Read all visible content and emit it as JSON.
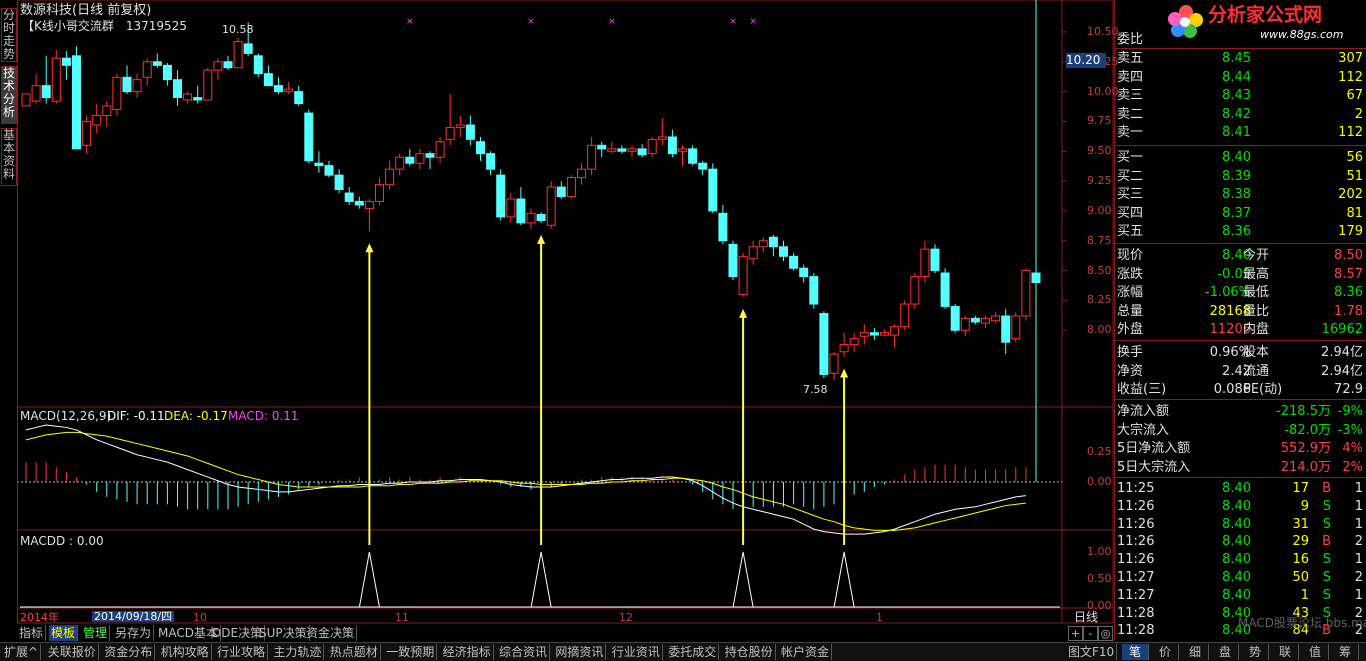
{
  "header": {
    "title": "数源科技(日线 前复权)",
    "group_note": "【K线小哥交流群　13719525",
    "label_high": "10.58",
    "label_low": "7.58"
  },
  "side_tabs": [
    "分时走势",
    "技术分析",
    "基本资料"
  ],
  "price_axis": [
    "10.50",
    "10.25",
    "10.00",
    "9.75",
    "9.50",
    "9.25",
    "9.00",
    "8.75",
    "8.50",
    "8.25",
    "8.00"
  ],
  "current_price_box": "10.20",
  "macd": {
    "title": "MACD(12,26,9)",
    "dif": "DIF: -0.11",
    "dea": "DEA: -0.17",
    "macd": "MACD: 0.11",
    "axis": [
      "0.25",
      "0.00"
    ]
  },
  "macdd": {
    "title": "MACDD : 0.00",
    "axis": [
      "1.00",
      "0.50",
      "0.00"
    ]
  },
  "date_axis": {
    "year": "2014年",
    "cursor_date": "2014/09/18/四",
    "months": [
      "10",
      "11",
      "12",
      "1"
    ],
    "period": "日线"
  },
  "chart_data": {
    "type": "candlestick",
    "title": "数源科技(日线 前复权)",
    "ylim": [
      7.55,
      10.6
    ],
    "candles": [
      [
        9.88,
        9.98,
        9.92,
        9.98
      ],
      [
        9.92,
        10.15,
        9.9,
        10.05
      ],
      [
        10.05,
        10.3,
        9.9,
        9.95
      ],
      [
        9.92,
        10.35,
        9.9,
        10.28
      ],
      [
        10.28,
        10.34,
        10.1,
        10.22
      ],
      [
        10.3,
        10.38,
        9.55,
        9.52
      ],
      [
        9.55,
        9.8,
        9.48,
        9.75
      ],
      [
        9.72,
        9.9,
        9.65,
        9.8
      ],
      [
        9.8,
        9.92,
        9.7,
        9.88
      ],
      [
        9.85,
        10.15,
        9.8,
        10.12
      ],
      [
        10.12,
        10.22,
        9.98,
        10.0
      ],
      [
        10.0,
        10.15,
        9.95,
        10.1
      ],
      [
        10.12,
        10.28,
        10.05,
        10.25
      ],
      [
        10.25,
        10.32,
        10.2,
        10.22
      ],
      [
        10.22,
        10.24,
        10.05,
        10.1
      ],
      [
        10.1,
        10.18,
        9.88,
        9.95
      ],
      [
        9.93,
        10.0,
        9.9,
        9.98
      ],
      [
        9.95,
        10.05,
        9.9,
        9.93
      ],
      [
        9.93,
        10.2,
        9.95,
        10.18
      ],
      [
        10.18,
        10.28,
        10.1,
        10.25
      ],
      [
        10.25,
        10.3,
        10.18,
        10.2
      ],
      [
        10.2,
        10.45,
        10.22,
        10.42
      ],
      [
        10.4,
        10.58,
        10.3,
        10.32
      ],
      [
        10.3,
        10.32,
        10.12,
        10.15
      ],
      [
        10.15,
        10.22,
        10.05,
        10.05
      ],
      [
        10.05,
        10.12,
        9.98,
        10.0
      ],
      [
        10.0,
        10.08,
        9.98,
        10.02
      ],
      [
        10.0,
        10.05,
        9.88,
        9.9
      ],
      [
        9.82,
        9.85,
        9.4,
        9.42
      ],
      [
        9.4,
        9.5,
        9.32,
        9.38
      ],
      [
        9.38,
        9.42,
        9.28,
        9.3
      ],
      [
        9.3,
        9.35,
        9.15,
        9.18
      ],
      [
        9.15,
        9.2,
        9.05,
        9.08
      ],
      [
        9.08,
        9.12,
        9.02,
        9.05
      ],
      [
        9.02,
        9.1,
        8.83,
        9.08
      ],
      [
        9.08,
        9.28,
        9.05,
        9.22
      ],
      [
        9.22,
        9.42,
        9.18,
        9.35
      ],
      [
        9.35,
        9.48,
        9.3,
        9.45
      ],
      [
        9.45,
        9.52,
        9.38,
        9.4
      ],
      [
        9.4,
        9.52,
        9.35,
        9.48
      ],
      [
        9.48,
        9.5,
        9.35,
        9.45
      ],
      [
        9.45,
        9.62,
        9.4,
        9.58
      ],
      [
        9.6,
        9.98,
        9.55,
        9.7
      ],
      [
        9.7,
        9.8,
        9.62,
        9.72
      ],
      [
        9.72,
        9.8,
        9.55,
        9.6
      ],
      [
        9.58,
        9.62,
        9.42,
        9.48
      ],
      [
        9.48,
        9.5,
        9.3,
        9.35
      ],
      [
        9.3,
        9.35,
        8.92,
        8.95
      ],
      [
        8.95,
        9.15,
        8.9,
        9.1
      ],
      [
        9.1,
        9.2,
        8.88,
        8.9
      ],
      [
        8.9,
        9.02,
        8.85,
        8.98
      ],
      [
        8.97,
        8.99,
        8.9,
        8.92
      ],
      [
        8.88,
        9.25,
        8.85,
        9.2
      ],
      [
        9.2,
        9.25,
        9.1,
        9.12
      ],
      [
        9.12,
        9.3,
        9.1,
        9.28
      ],
      [
        9.28,
        9.4,
        9.22,
        9.35
      ],
      [
        9.35,
        9.62,
        9.3,
        9.55
      ],
      [
        9.55,
        9.58,
        9.45,
        9.52
      ],
      [
        9.5,
        9.58,
        9.48,
        9.52
      ],
      [
        9.52,
        9.55,
        9.48,
        9.5
      ],
      [
        9.5,
        9.55,
        9.45,
        9.52
      ],
      [
        9.52,
        9.56,
        9.45,
        9.47
      ],
      [
        9.48,
        9.62,
        9.45,
        9.6
      ],
      [
        9.6,
        9.78,
        9.55,
        9.62
      ],
      [
        9.62,
        9.68,
        9.45,
        9.48
      ],
      [
        9.5,
        9.55,
        9.38,
        9.52
      ],
      [
        9.52,
        9.55,
        9.38,
        9.4
      ],
      [
        9.4,
        9.42,
        9.3,
        9.35
      ],
      [
        9.35,
        9.4,
        8.98,
        9.0
      ],
      [
        8.98,
        9.05,
        8.72,
        8.75
      ],
      [
        8.72,
        8.75,
        8.42,
        8.45
      ],
      [
        8.3,
        8.65,
        8.28,
        8.62
      ],
      [
        8.6,
        8.75,
        8.55,
        8.7
      ],
      [
        8.7,
        8.78,
        8.65,
        8.75
      ],
      [
        8.78,
        8.8,
        8.62,
        8.7
      ],
      [
        8.7,
        8.75,
        8.58,
        8.62
      ],
      [
        8.62,
        8.65,
        8.5,
        8.52
      ],
      [
        8.52,
        8.55,
        8.4,
        8.45
      ],
      [
        8.45,
        8.48,
        8.18,
        8.22
      ],
      [
        8.14,
        8.16,
        7.6,
        7.63
      ],
      [
        7.64,
        7.82,
        7.58,
        7.8
      ],
      [
        7.82,
        7.98,
        7.78,
        7.88
      ],
      [
        7.88,
        7.98,
        7.82,
        7.93
      ],
      [
        7.95,
        8.05,
        7.88,
        7.98
      ],
      [
        7.98,
        8.02,
        7.92,
        7.96
      ],
      [
        7.96,
        8.0,
        7.95,
        7.98
      ],
      [
        7.96,
        8.05,
        7.85,
        8.03
      ],
      [
        8.03,
        8.25,
        8.0,
        8.22
      ],
      [
        8.22,
        8.48,
        8.18,
        8.45
      ],
      [
        8.45,
        8.75,
        8.4,
        8.68
      ],
      [
        8.68,
        8.72,
        8.48,
        8.5
      ],
      [
        8.48,
        8.52,
        8.18,
        8.2
      ],
      [
        8.2,
        8.22,
        7.98,
        8.0
      ],
      [
        8.0,
        8.12,
        7.95,
        8.1
      ],
      [
        8.1,
        8.12,
        8.05,
        8.07
      ],
      [
        8.06,
        8.12,
        8.02,
        8.1
      ],
      [
        8.08,
        8.15,
        8.06,
        8.12
      ],
      [
        8.12,
        8.18,
        7.8,
        7.9
      ],
      [
        7.93,
        8.15,
        7.9,
        8.12
      ],
      [
        8.12,
        8.52,
        8.08,
        8.5
      ],
      [
        8.48,
        8.58,
        8.35,
        8.4
      ]
    ],
    "macd_dif": [
      0.42,
      0.44,
      0.46,
      0.45,
      0.44,
      0.42,
      0.38,
      0.34,
      0.31,
      0.28,
      0.25,
      0.22,
      0.2,
      0.18,
      0.16,
      0.13,
      0.1,
      0.07,
      0.04,
      0.01,
      -0.02,
      -0.04,
      -0.05,
      -0.06,
      -0.07,
      -0.08,
      -0.08,
      -0.07,
      -0.06,
      -0.05,
      -0.04,
      -0.03,
      -0.03,
      -0.02,
      -0.02,
      -0.02,
      -0.01,
      -0.01,
      0.0,
      0.0,
      0.0,
      0.01,
      0.01,
      0.02,
      0.02,
      0.02,
      0.01,
      0.0,
      -0.02,
      -0.03,
      -0.04,
      -0.04,
      -0.04,
      -0.03,
      -0.02,
      -0.01,
      0.0,
      0.01,
      0.02,
      0.02,
      0.03,
      0.03,
      0.03,
      0.04,
      0.04,
      0.03,
      0.01,
      -0.03,
      -0.08,
      -0.13,
      -0.17,
      -0.2,
      -0.22,
      -0.24,
      -0.26,
      -0.28,
      -0.3,
      -0.34,
      -0.38,
      -0.4,
      -0.41,
      -0.42,
      -0.42,
      -0.42,
      -0.41,
      -0.4,
      -0.38,
      -0.35,
      -0.32,
      -0.29,
      -0.26,
      -0.24,
      -0.22,
      -0.21,
      -0.2,
      -0.18,
      -0.16,
      -0.14,
      -0.12,
      -0.11
    ],
    "macd_dea": [
      0.34,
      0.36,
      0.38,
      0.39,
      0.4,
      0.4,
      0.39,
      0.38,
      0.37,
      0.35,
      0.33,
      0.31,
      0.29,
      0.27,
      0.25,
      0.23,
      0.21,
      0.18,
      0.15,
      0.12,
      0.09,
      0.06,
      0.04,
      0.02,
      0.0,
      -0.02,
      -0.03,
      -0.04,
      -0.04,
      -0.04,
      -0.04,
      -0.04,
      -0.04,
      -0.04,
      -0.03,
      -0.03,
      -0.03,
      -0.02,
      -0.02,
      -0.01,
      -0.01,
      -0.01,
      0.0,
      0.0,
      0.01,
      0.01,
      0.01,
      0.01,
      0.0,
      -0.01,
      -0.01,
      -0.02,
      -0.02,
      -0.02,
      -0.02,
      -0.02,
      -0.01,
      -0.01,
      0.0,
      0.0,
      0.01,
      0.01,
      0.02,
      0.02,
      0.03,
      0.03,
      0.02,
      0.01,
      -0.01,
      -0.04,
      -0.06,
      -0.09,
      -0.12,
      -0.14,
      -0.16,
      -0.18,
      -0.21,
      -0.24,
      -0.27,
      -0.3,
      -0.32,
      -0.35,
      -0.37,
      -0.38,
      -0.39,
      -0.39,
      -0.39,
      -0.38,
      -0.37,
      -0.35,
      -0.33,
      -0.31,
      -0.29,
      -0.27,
      -0.25,
      -0.23,
      -0.21,
      -0.19,
      -0.18,
      -0.17
    ],
    "signals": [
      34,
      51,
      71,
      81
    ],
    "annotations": [
      "10.58",
      "7.58"
    ]
  },
  "right_panel": {
    "weibi": "委比",
    "asks": [
      {
        "label": "卖五",
        "price": "8.45",
        "vol": "307"
      },
      {
        "label": "卖四",
        "price": "8.44",
        "vol": "112"
      },
      {
        "label": "卖三",
        "price": "8.43",
        "vol": "67"
      },
      {
        "label": "卖二",
        "price": "8.42",
        "vol": "2"
      },
      {
        "label": "卖一",
        "price": "8.41",
        "vol": "112"
      }
    ],
    "bids": [
      {
        "label": "买一",
        "price": "8.40",
        "vol": "56"
      },
      {
        "label": "买二",
        "price": "8.39",
        "vol": "51"
      },
      {
        "label": "买三",
        "price": "8.38",
        "vol": "202"
      },
      {
        "label": "买四",
        "price": "8.37",
        "vol": "81"
      },
      {
        "label": "买五",
        "price": "8.36",
        "vol": "179"
      }
    ],
    "quote": [
      {
        "l1": "现价",
        "v1": "8.40",
        "l2": "今开",
        "v2": "8.50",
        "c1": "#00e000",
        "c2": "#ff4040"
      },
      {
        "l1": "涨跌",
        "v1": "-0.09",
        "l2": "最高",
        "v2": "8.57",
        "c1": "#00e000",
        "c2": "#ff4040"
      },
      {
        "l1": "涨幅",
        "v1": "-1.06%",
        "l2": "最低",
        "v2": "8.36",
        "c1": "#00e000",
        "c2": "#00e000"
      },
      {
        "l1": "总量",
        "v1": "28168",
        "l2": "量比",
        "v2": "1.78",
        "c1": "#ffff00",
        "c2": "#ff4040"
      },
      {
        "l1": "外盘",
        "v1": "11206",
        "l2": "内盘",
        "v2": "16962",
        "c1": "#ff4040",
        "c2": "#00e000"
      }
    ],
    "stats": [
      {
        "l1": "换手",
        "v1": "0.96%",
        "l2": "股本",
        "v2": "2.94亿"
      },
      {
        "l1": "净资",
        "v1": "2.42",
        "l2": "流通",
        "v2": "2.94亿"
      },
      {
        "l1": "收益(三)",
        "v1": "0.086",
        "l2": "PE(动)",
        "v2": "72.9"
      }
    ],
    "flows": [
      {
        "l": "净流入额",
        "v": "-218.5万",
        "p": "-9%",
        "c": "#00e000"
      },
      {
        "l": "大宗流入",
        "v": "-82.0万",
        "p": "-3%",
        "c": "#00e000"
      },
      {
        "l": "5日净流入额",
        "v": "552.9万",
        "p": "4%",
        "c": "#ff4040"
      },
      {
        "l": "5日大宗流入",
        "v": "214.0万",
        "p": "2%",
        "c": "#ff4040"
      }
    ],
    "ticks": [
      {
        "t": "11:25",
        "p": "8.40",
        "v": "17",
        "bs": "B",
        "n": "1"
      },
      {
        "t": "11:26",
        "p": "8.40",
        "v": "9",
        "bs": "S",
        "n": "1"
      },
      {
        "t": "11:26",
        "p": "8.40",
        "v": "31",
        "bs": "S",
        "n": "1"
      },
      {
        "t": "11:26",
        "p": "8.40",
        "v": "29",
        "bs": "B",
        "n": "2"
      },
      {
        "t": "11:26",
        "p": "8.40",
        "v": "16",
        "bs": "S",
        "n": "1"
      },
      {
        "t": "11:27",
        "p": "8.40",
        "v": "50",
        "bs": "S",
        "n": "2"
      },
      {
        "t": "11:27",
        "p": "8.40",
        "v": "1",
        "bs": "S",
        "n": "1"
      },
      {
        "t": "11:28",
        "p": "8.40",
        "v": "43",
        "bs": "S",
        "n": "2"
      },
      {
        "t": "11:28",
        "p": "8.40",
        "v": "84",
        "bs": "B",
        "n": "2"
      }
    ]
  },
  "logo": {
    "main": "分析家公式网",
    "url": "www.88gs.com"
  },
  "toolbar1": [
    "指标",
    "模板",
    "管理",
    "另存为",
    "MACD基本",
    "DDE决策",
    "SUP决策",
    "资金决策"
  ],
  "toolbar2": [
    "扩展^",
    "关联报价",
    "资金分布",
    "机构攻略",
    "行业攻略",
    "主力轨迹",
    "热点题材",
    "一致预期",
    "经济指标",
    "综合资讯",
    "网摘资讯",
    "行业资讯",
    "委托成交",
    "持仓股份",
    "帐户资金"
  ],
  "bottom_right": {
    "page": "图文F10",
    "tabs": [
      "笔",
      "价",
      "细",
      "盘",
      "势",
      "联",
      "值",
      "筹"
    ]
  },
  "zoom_btns": [
    "+",
    "-",
    "◎"
  ],
  "watermark": "MACD股票论坛 bbs.macd.cn",
  "colors": {
    "up": "#ff3030",
    "down": "#54ffff",
    "dif": "#ffffff",
    "dea": "#ffff00",
    "grid": "#8a1c1c",
    "arrow": "#ffff40"
  }
}
